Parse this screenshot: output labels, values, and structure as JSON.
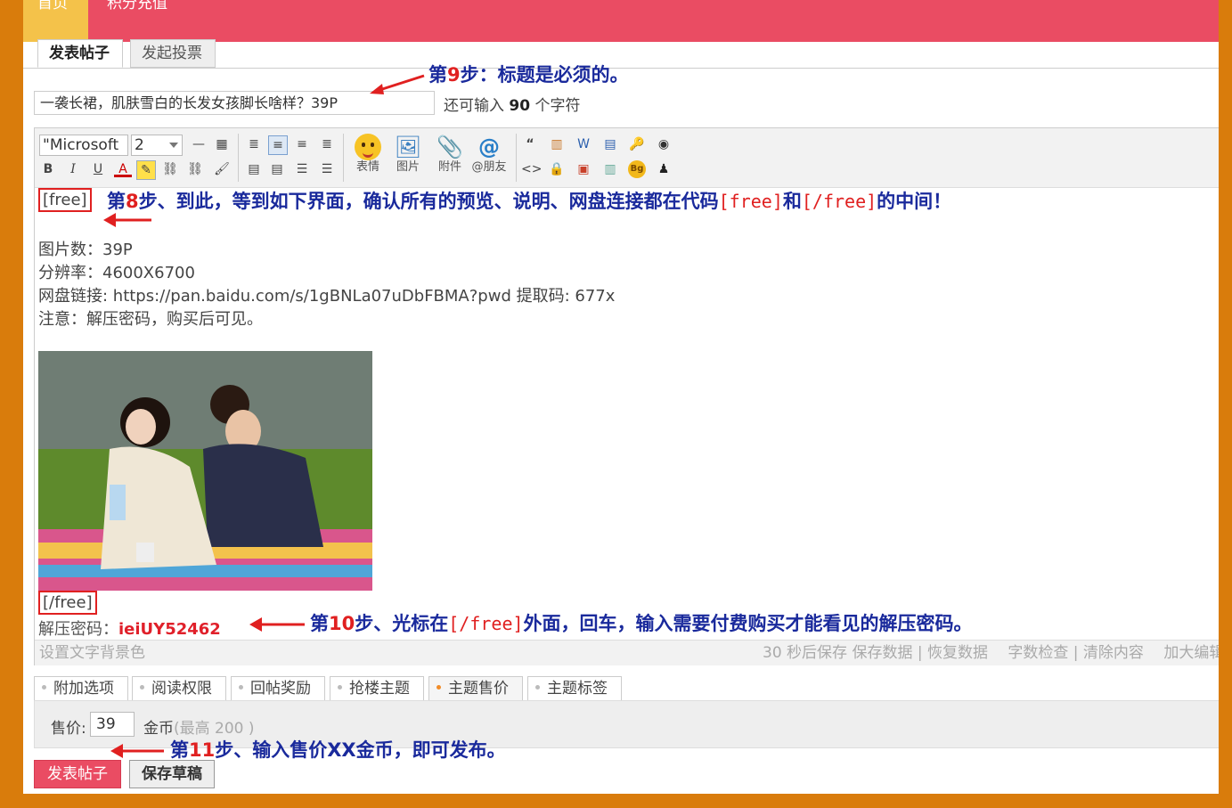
{
  "nav": {
    "home": "首页",
    "recharge": "积分充值"
  },
  "post_tabs": {
    "post": "发表帖子",
    "poll": "发起投票"
  },
  "subject": {
    "value": "一袭长裙，肌肤雪白的长发女孩脚长啥样？39P",
    "remain_prefix": "还可输入",
    "remain_count": "90",
    "remain_suffix": "个字符"
  },
  "toolbar": {
    "font": "\"Microsoft",
    "size": "2",
    "emoticon": "表情",
    "image": "图片",
    "attach": "附件",
    "at": "@朋友"
  },
  "content": {
    "free_open": "[free]",
    "line1": "图片数：39P",
    "line2": "分辨率：4600X6700",
    "line3": "网盘链接: https://pan.baidu.com/s/1gBNLa07uDbFBMA?pwd 提取码: 677x",
    "line4": "注意：解压密码，购买后可见。",
    "free_close": "[/free]",
    "pwd_label": "解压密码：",
    "pwd_value": "ieiUY52462"
  },
  "statusbar": {
    "left": "设置文字背景色",
    "right": "30 秒后保存 保存数据 | 恢复数据 　字数检查 | 清除内容 　加大编辑"
  },
  "extra_tabs": [
    "附加选项",
    "阅读权限",
    "回帖奖励",
    "抢楼主题",
    "主题售价",
    "主题标签"
  ],
  "price": {
    "label": "售价:",
    "value": "39",
    "unit": "金币",
    "max": "(最高 200 )"
  },
  "buttons": {
    "post": "发表帖子",
    "draft": "保存草稿"
  },
  "annotations": {
    "step9": {
      "pre": "第",
      "num": "9",
      "post": "步：标题是必须的。"
    },
    "step8": {
      "pre": "第",
      "num": "8",
      "mid": "步、到此，等到如下界面，确认所有的预览、说明、网盘连接都在代码",
      "code1": "[free]",
      "and": "和",
      "code2": "[/free]",
      "post": "的中间！"
    },
    "step10": {
      "pre": "第",
      "num": "10",
      "mid": "步、光标在",
      "code": "[/free]",
      "post": "外面，回车，输入需要付费购买才能看见的解压密码。"
    },
    "step11": {
      "pre": "第",
      "num": "11",
      "post": "步、输入售价XX金币，即可发布。"
    }
  },
  "colors": {
    "frame": "#d97c0c",
    "nav": "#ea4c63",
    "home_tab": "#f4c24a",
    "annotation": "#1a2a9c",
    "highlight": "#e02020"
  }
}
